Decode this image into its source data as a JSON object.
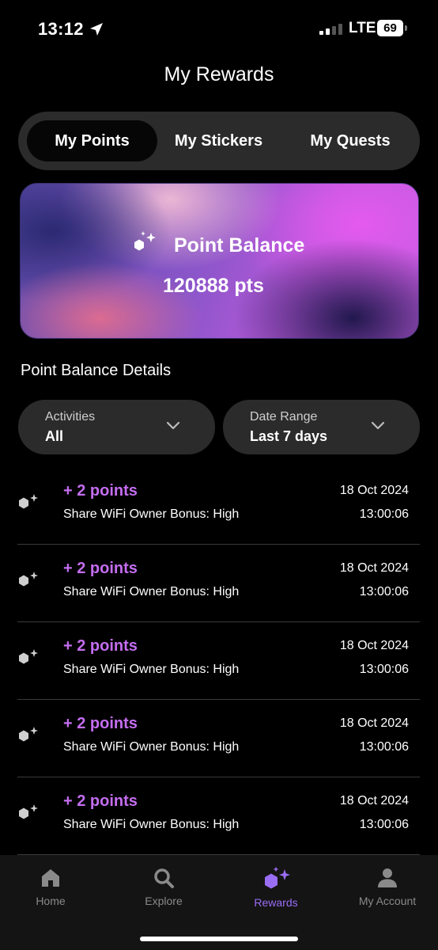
{
  "status_bar": {
    "time": "13:12",
    "network": "LTE",
    "battery": "69"
  },
  "page_title": "My Rewards",
  "tabs": [
    {
      "label": "My Points",
      "active": true
    },
    {
      "label": "My Stickers",
      "active": false
    },
    {
      "label": "My Quests",
      "active": false
    }
  ],
  "balance_card": {
    "title": "Point Balance",
    "value": "120888 pts",
    "icon": "sparkle-cube-icon"
  },
  "section_title": "Point Balance Details",
  "filters": {
    "activities": {
      "label": "Activities",
      "value": "All"
    },
    "date_range": {
      "label": "Date Range",
      "value": "Last 7 days"
    }
  },
  "activity_list": [
    {
      "points": "+ 2 points",
      "description": "Share WiFi Owner Bonus: High",
      "date": "18 Oct 2024",
      "time": "13:00:06"
    },
    {
      "points": "+ 2 points",
      "description": "Share WiFi Owner Bonus: High",
      "date": "18 Oct 2024",
      "time": "13:00:06"
    },
    {
      "points": "+ 2 points",
      "description": "Share WiFi Owner Bonus: High",
      "date": "18 Oct 2024",
      "time": "13:00:06"
    },
    {
      "points": "+ 2 points",
      "description": "Share WiFi Owner Bonus: High",
      "date": "18 Oct 2024",
      "time": "13:00:06"
    },
    {
      "points": "+ 2 points",
      "description": "Share WiFi Owner Bonus: High",
      "date": "18 Oct 2024",
      "time": "13:00:06"
    }
  ],
  "bottom_nav": [
    {
      "label": "Home",
      "icon": "home-icon",
      "active": false
    },
    {
      "label": "Explore",
      "icon": "search-icon",
      "active": false
    },
    {
      "label": "Rewards",
      "icon": "sparkle-cube-icon",
      "active": true
    },
    {
      "label": "My Account",
      "icon": "person-icon",
      "active": false
    }
  ],
  "colors": {
    "accent": "#c46df0",
    "nav_active": "#9a6df5",
    "background": "#000000",
    "surface": "#2b2b2b"
  }
}
